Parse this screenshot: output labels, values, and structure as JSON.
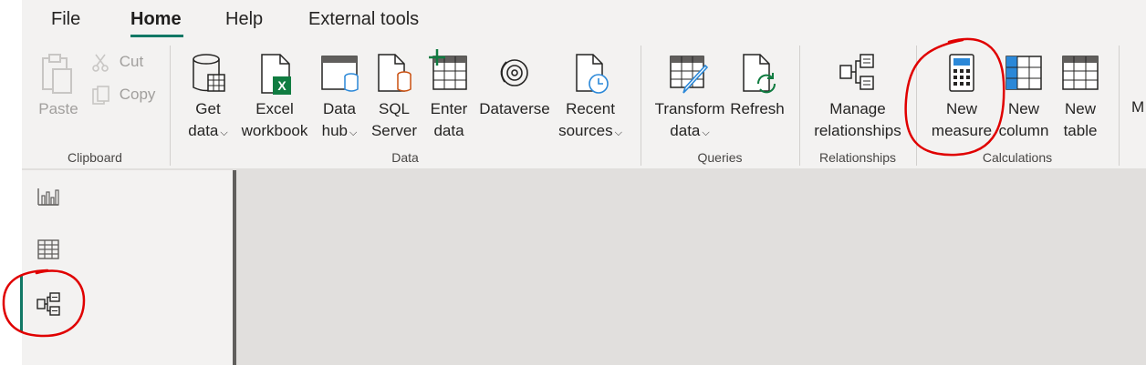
{
  "tabs": [
    "File",
    "Home",
    "Help",
    "External tools"
  ],
  "clipboard": {
    "paste": "Paste",
    "cut": "Cut",
    "copy": "Copy",
    "group": "Clipboard"
  },
  "data": {
    "get_data_1": "Get",
    "get_data_2": "data",
    "excel_1": "Excel",
    "excel_2": "workbook",
    "datahub_1": "Data",
    "datahub_2": "hub",
    "sql_1": "SQL",
    "sql_2": "Server",
    "enter_1": "Enter",
    "enter_2": "data",
    "dataverse": "Dataverse",
    "recent_1": "Recent",
    "recent_2": "sources",
    "group": "Data"
  },
  "queries": {
    "transform_1": "Transform",
    "transform_2": "data",
    "refresh": "Refresh",
    "group": "Queries"
  },
  "relationships": {
    "manage_1": "Manage",
    "manage_2": "relationships",
    "group": "Relationships"
  },
  "calculations": {
    "measure_1": "New",
    "measure_2": "measure",
    "column_1": "New",
    "column_2": "column",
    "table_1": "New",
    "table_2": "table",
    "group": "Calculations"
  },
  "overflow_label": "M",
  "colors": {
    "accent": "#117865",
    "annotation": "#e00000",
    "ribbon": "#f3f2f1",
    "canvas": "#e1dfdd"
  },
  "icons": [
    "paste-icon",
    "cut-icon",
    "copy-icon",
    "get-data-icon",
    "excel-icon",
    "data-hub-icon",
    "sql-server-icon",
    "enter-data-icon",
    "dataverse-icon",
    "recent-sources-icon",
    "transform-data-icon",
    "refresh-icon",
    "manage-relationships-icon",
    "new-measure-icon",
    "new-column-icon",
    "new-table-icon",
    "report-view-icon",
    "data-view-icon",
    "model-view-icon"
  ]
}
